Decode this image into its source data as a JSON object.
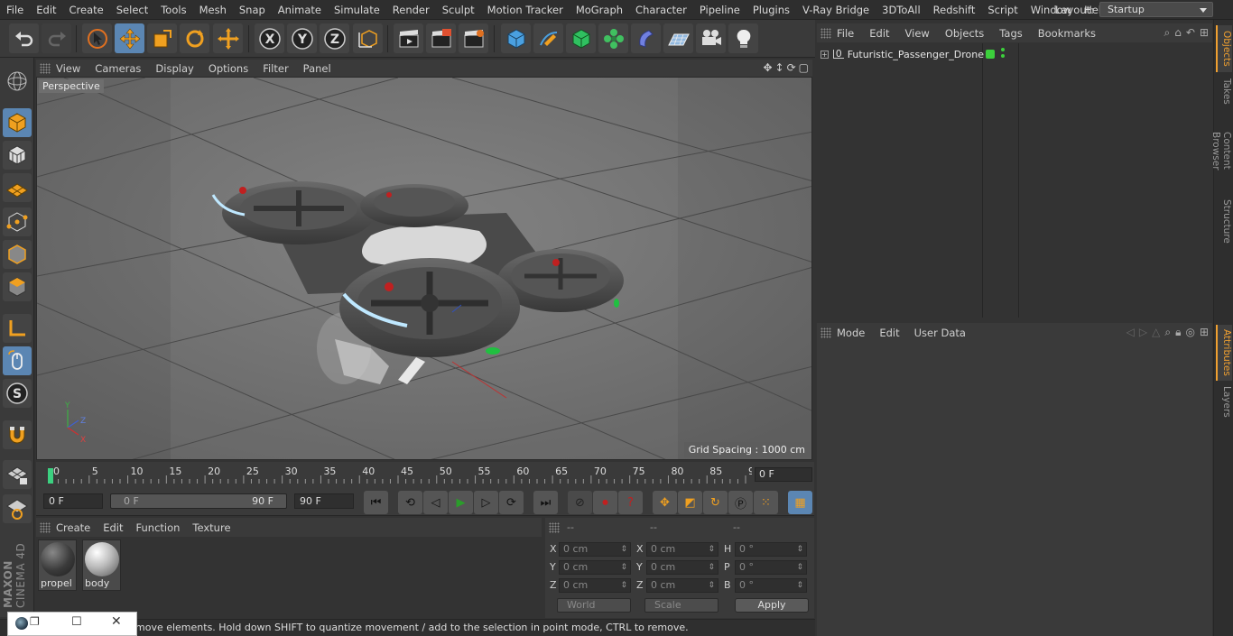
{
  "menu": [
    "File",
    "Edit",
    "Create",
    "Select",
    "Tools",
    "Mesh",
    "Snap",
    "Animate",
    "Simulate",
    "Render",
    "Sculpt",
    "Motion Tracker",
    "MoGraph",
    "Character",
    "Pipeline",
    "Plugins",
    "V-Ray Bridge",
    "3DToAll",
    "Redshift",
    "Script",
    "Window",
    "Help"
  ],
  "layout": {
    "label": "Layout:",
    "value": "Startup"
  },
  "viewport": {
    "menu": [
      "View",
      "Cameras",
      "Display",
      "Options",
      "Filter",
      "Panel"
    ],
    "camera_label": "Perspective",
    "grid_spacing": "Grid Spacing : 1000 cm",
    "axis": {
      "x": "X",
      "y": "Y",
      "z": "Z"
    }
  },
  "timeline": {
    "ticks": [
      "0",
      "5",
      "10",
      "15",
      "20",
      "25",
      "30",
      "35",
      "40",
      "45",
      "50",
      "55",
      "60",
      "65",
      "70",
      "75",
      "80",
      "85",
      "90"
    ],
    "current_frame": "0 F"
  },
  "transport": {
    "start_field": "0 F",
    "range_start": "0 F",
    "range_end": "90 F",
    "end_field": "90 F"
  },
  "materials": {
    "menu": [
      "Create",
      "Edit",
      "Function",
      "Texture"
    ],
    "items": [
      {
        "name": "propel"
      },
      {
        "name": "body"
      }
    ]
  },
  "coords": {
    "headers": [
      "--",
      "--",
      "--"
    ],
    "rows": [
      {
        "a": "X",
        "av": "0 cm",
        "b": "X",
        "bv": "0 cm",
        "c": "H",
        "cv": "0 °"
      },
      {
        "a": "Y",
        "av": "0 cm",
        "b": "Y",
        "bv": "0 cm",
        "c": "P",
        "cv": "0 °"
      },
      {
        "a": "Z",
        "av": "0 cm",
        "b": "Z",
        "bv": "0 cm",
        "c": "B",
        "cv": "0 °"
      }
    ],
    "world": "World",
    "scale": "Scale",
    "apply": "Apply"
  },
  "status": "move elements. Hold down SHIFT to quantize movement / add to the selection in point mode, CTRL to remove.",
  "object_manager": {
    "menu": [
      "File",
      "Edit",
      "View",
      "Objects",
      "Tags",
      "Bookmarks"
    ],
    "object_name": "Futuristic_Passenger_Drone"
  },
  "attribute_manager": {
    "menu": [
      "Mode",
      "Edit",
      "User Data"
    ]
  },
  "vertical_tabs": [
    "Objects",
    "Takes",
    "Content Browser",
    "Structure",
    "Attributes",
    "Layers"
  ],
  "logo": {
    "line1": "MAXON",
    "line2": "CINEMA 4D"
  },
  "colors": {
    "accent": "#5b86b3",
    "active_tab": "#f0a030",
    "viewport_bg": "#6a6a6a"
  }
}
